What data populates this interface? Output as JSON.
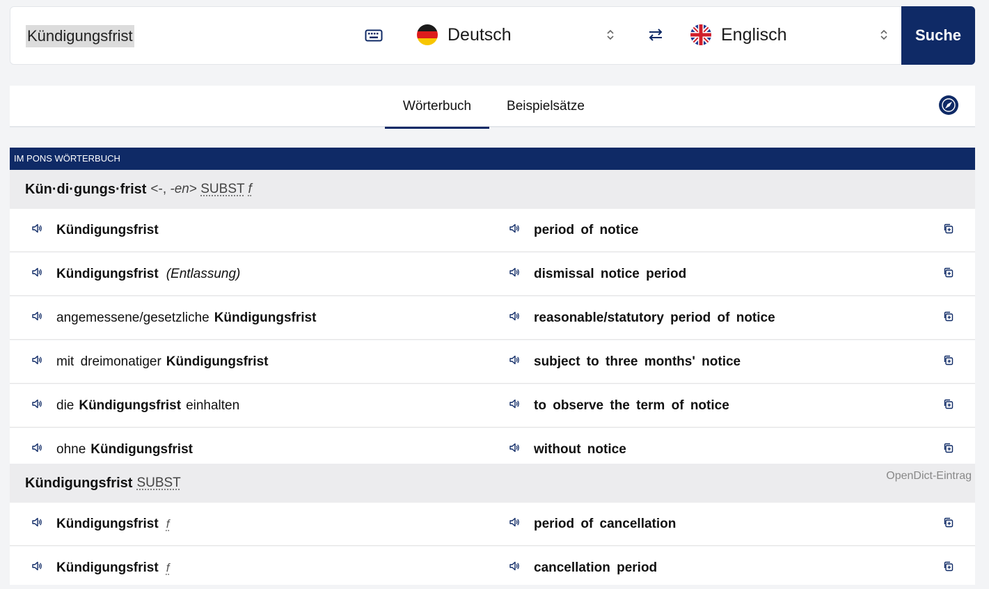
{
  "search": {
    "query": "Kündigungsfrist",
    "source_lang": "Deutsch",
    "target_lang": "Englisch",
    "button_label": "Suche"
  },
  "tabs": [
    {
      "label": "Wörterbuch",
      "active": true
    },
    {
      "label": "Beispielsätze",
      "active": false
    }
  ],
  "section_header": "IM PONS WÖRTERBUCH",
  "entries": [
    {
      "headword": "Kün·di·gungs·frist",
      "grammar_pre": "<-, ",
      "grammar_italic": "-en",
      "grammar_post": ">",
      "pos": "SUBST",
      "gender": "f",
      "rows": [
        {
          "pre": "",
          "bold": "Kündigungsfrist",
          "post": "",
          "context": "",
          "target": "period of notice"
        },
        {
          "pre": "",
          "bold": "Kündigungsfrist",
          "post": "",
          "context": "(Entlassung)",
          "target": "dismissal notice period"
        },
        {
          "pre": "angemessene/gesetzliche",
          "bold": "Kündigungsfrist",
          "post": "",
          "context": "",
          "target": "reasonable/statutory period of notice"
        },
        {
          "pre": "mit dreimonatiger",
          "bold": "Kündigungsfrist",
          "post": "",
          "context": "",
          "target": "subject to three months' notice"
        },
        {
          "pre": "die",
          "bold": "Kündigungsfrist",
          "post": "einhalten",
          "context": "",
          "target": "to observe the term of notice"
        },
        {
          "pre": "ohne",
          "bold": "Kündigungsfrist",
          "post": "",
          "context": "",
          "target": "without notice"
        }
      ]
    },
    {
      "headword": "Kündigungsfrist",
      "pos": "SUBST",
      "badge": "OpenDict-Eintrag",
      "rows": [
        {
          "bold": "Kündigungsfrist",
          "gender": "f",
          "target": "period of cancellation"
        },
        {
          "bold": "Kündigungsfrist",
          "gender": "f",
          "target": "cancellation period"
        }
      ]
    }
  ],
  "icons": {
    "keyboard": "keyboard-icon",
    "swap": "swap-icon",
    "compass": "compass-icon",
    "speaker": "speaker-icon",
    "copy": "copy-icon"
  },
  "colors": {
    "brand": "#0f2a66",
    "headword_bg": "#ececee"
  }
}
